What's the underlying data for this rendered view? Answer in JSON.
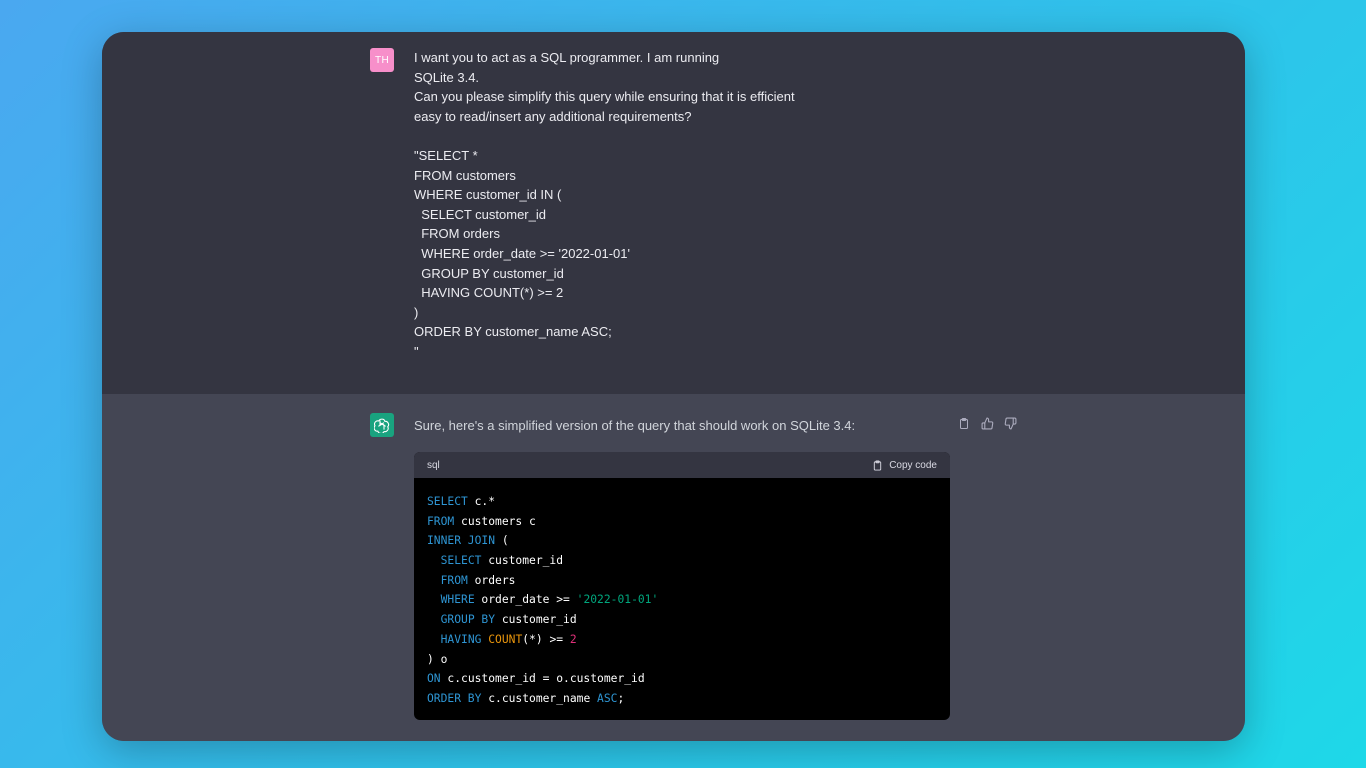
{
  "user": {
    "avatar_initials": "TH",
    "message_lines": [
      "I want you to act as a SQL programmer. I am running",
      "SQLite 3.4.",
      "Can you please simplify this query while ensuring that it is efficient",
      "easy to read/insert any additional requirements?",
      "",
      "\"SELECT *",
      "FROM customers",
      "WHERE customer_id IN (",
      "  SELECT customer_id",
      "  FROM orders",
      "  WHERE order_date >= '2022-01-01'",
      "  GROUP BY customer_id",
      "  HAVING COUNT(*) >= 2",
      ")",
      "ORDER BY customer_name ASC;",
      "\""
    ]
  },
  "assistant": {
    "intro": "Sure, here's a simplified version of the query that should work on SQLite 3.4:",
    "code_language": "sql",
    "copy_label": "Copy code",
    "code_lines": [
      [
        {
          "t": "SELECT",
          "c": "kw"
        },
        {
          "t": " c.*",
          "c": ""
        }
      ],
      [
        {
          "t": "FROM",
          "c": "kw"
        },
        {
          "t": " customers c",
          "c": ""
        }
      ],
      [
        {
          "t": "INNER JOIN",
          "c": "kw"
        },
        {
          "t": " (",
          "c": ""
        }
      ],
      [
        {
          "t": "  ",
          "c": ""
        },
        {
          "t": "SELECT",
          "c": "kw"
        },
        {
          "t": " customer_id",
          "c": ""
        }
      ],
      [
        {
          "t": "  ",
          "c": ""
        },
        {
          "t": "FROM",
          "c": "kw"
        },
        {
          "t": " orders",
          "c": ""
        }
      ],
      [
        {
          "t": "  ",
          "c": ""
        },
        {
          "t": "WHERE",
          "c": "kw"
        },
        {
          "t": " order_date >= ",
          "c": ""
        },
        {
          "t": "'2022-01-01'",
          "c": "str"
        }
      ],
      [
        {
          "t": "  ",
          "c": ""
        },
        {
          "t": "GROUP BY",
          "c": "kw"
        },
        {
          "t": " customer_id",
          "c": ""
        }
      ],
      [
        {
          "t": "  ",
          "c": ""
        },
        {
          "t": "HAVING",
          "c": "kw"
        },
        {
          "t": " ",
          "c": ""
        },
        {
          "t": "COUNT",
          "c": "count"
        },
        {
          "t": "(*) >= ",
          "c": ""
        },
        {
          "t": "2",
          "c": "num"
        }
      ],
      [
        {
          "t": ") o",
          "c": ""
        }
      ],
      [
        {
          "t": "ON",
          "c": "kw"
        },
        {
          "t": " c.customer_id = o.customer_id",
          "c": ""
        }
      ],
      [
        {
          "t": "ORDER BY",
          "c": "kw"
        },
        {
          "t": " c.customer_name ",
          "c": ""
        },
        {
          "t": "ASC",
          "c": "kw"
        },
        {
          "t": ";",
          "c": ""
        }
      ]
    ]
  },
  "icons": {
    "copy": "clipboard-icon",
    "thumbs_up": "thumbs-up-icon",
    "thumbs_down": "thumbs-down-icon",
    "bot_avatar": "openai-logo-icon"
  },
  "colors": {
    "user_bg": "#343541",
    "assistant_bg": "#444654",
    "user_avatar": "#f78fca",
    "bot_avatar": "#19a37f",
    "keyword": "#2e95d3",
    "string": "#00a67d",
    "number": "#df3079",
    "function": "#e9950c"
  }
}
